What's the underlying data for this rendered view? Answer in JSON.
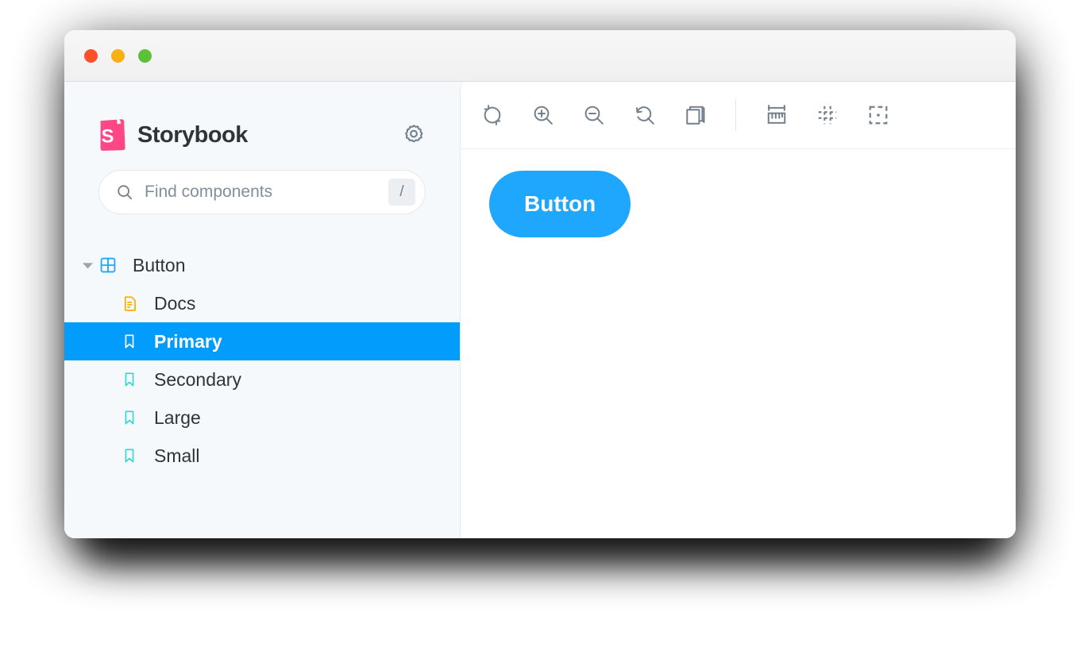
{
  "window": {
    "traffic_lights": [
      {
        "name": "close",
        "color": "#fc4f2c"
      },
      {
        "name": "minimize",
        "color": "#f9b012"
      },
      {
        "name": "maximize",
        "color": "#5dc039"
      }
    ]
  },
  "sidebar": {
    "brand": {
      "title": "Storybook",
      "logo_icon": "storybook-logo",
      "logo_color": "#ff4785"
    },
    "settings_icon": "gear-icon",
    "search": {
      "placeholder": "Find components",
      "value": "",
      "icon": "search-icon",
      "shortcut": "/"
    },
    "tree": [
      {
        "label": "Button",
        "level": 0,
        "icon": "component-grid-icon",
        "icon_color": "#1ea7fd",
        "expanded": true,
        "caret": "chevron-down-icon",
        "selected": false
      },
      {
        "label": "Docs",
        "level": 1,
        "icon": "document-icon",
        "icon_color": "#ffae00",
        "selected": false
      },
      {
        "label": "Primary",
        "level": 1,
        "icon": "bookmark-icon",
        "icon_color": "#ffffff",
        "selected": true
      },
      {
        "label": "Secondary",
        "level": 1,
        "icon": "bookmark-icon",
        "icon_color": "#37d5d3",
        "selected": false
      },
      {
        "label": "Large",
        "level": 1,
        "icon": "bookmark-icon",
        "icon_color": "#37d5d3",
        "selected": false
      },
      {
        "label": "Small",
        "level": 1,
        "icon": "bookmark-icon",
        "icon_color": "#37d5d3",
        "selected": false
      }
    ],
    "selected_color": "#029cfd"
  },
  "preview": {
    "toolbar": {
      "left_tools": [
        {
          "name": "remount-icon",
          "label": "Remount component"
        },
        {
          "name": "zoom-in-icon",
          "label": "Zoom in"
        },
        {
          "name": "zoom-out-icon",
          "label": "Zoom out"
        },
        {
          "name": "zoom-reset-icon",
          "label": "Reset zoom"
        },
        {
          "name": "change-background-icon",
          "label": "Change background"
        }
      ],
      "right_tools": [
        {
          "name": "measure-icon",
          "label": "Enable measure"
        },
        {
          "name": "grid-icon",
          "label": "Apply a grid to the preview"
        },
        {
          "name": "outline-icon",
          "label": "Apply outlines to the preview"
        }
      ]
    },
    "story": {
      "button_label": "Button",
      "button_color": "#1ea7fd",
      "button_text_color": "#ffffff"
    }
  }
}
